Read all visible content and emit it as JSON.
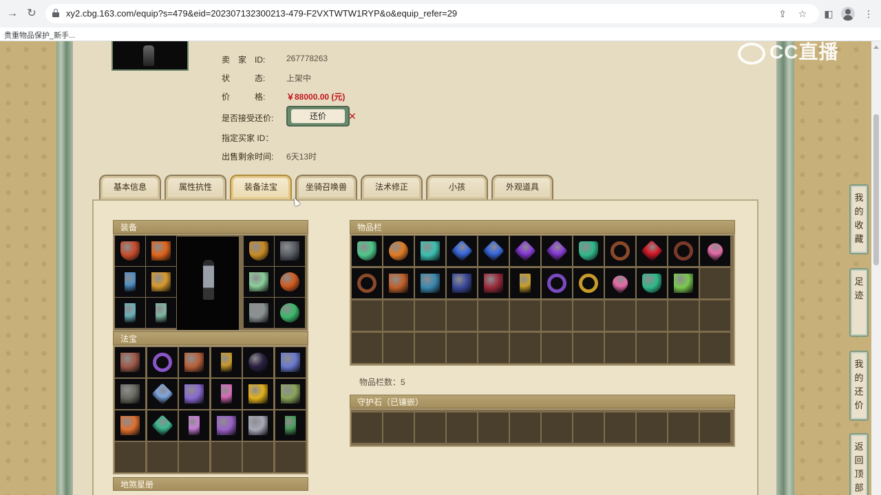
{
  "browser": {
    "url": "xy2.cbg.163.com/equip?s=479&eid=202307132300213-479-F2VXTWTW1RYP&o&equip_refer=29",
    "bookmark": "贵重物品保护_新手..."
  },
  "seller": {
    "seller_label": "卖　家　ID:",
    "seller_id": "267778263",
    "status_label": "状　　　态:",
    "status": "上架中",
    "price_label": "价　　　格:",
    "price": "￥88000.00 (元)",
    "haggle_label": "是否接受还价:",
    "haggle_button": "还价",
    "buyer_label": "指定买家 ID：",
    "remaining_label": "出售剩余时间:",
    "remaining": "6天13时"
  },
  "tabs": [
    {
      "label": "基本信息",
      "active": false
    },
    {
      "label": "属性抗性",
      "active": false
    },
    {
      "label": "装备法宝",
      "active": true
    },
    {
      "label": "坐骑召唤兽",
      "active": false
    },
    {
      "label": "法术修正",
      "active": false
    },
    {
      "label": "小孩",
      "active": false
    },
    {
      "label": "外观道具",
      "active": false
    }
  ],
  "sections": {
    "equipment": "装备",
    "treasure": "法宝",
    "constellation": "地煞星册",
    "inventory": "物品栏",
    "inventory_count": "物品栏数：5",
    "guardstone": "守护石（已镶嵌）"
  },
  "equipment_items": [
    {
      "icon": "hat-icon",
      "color": "#c64b2a"
    },
    {
      "icon": "flame-crown-icon",
      "color": "#e0651c"
    },
    {
      "icon": "mask-icon",
      "color": "#c88a22"
    },
    {
      "icon": "claw-icon",
      "color": "#5a5f66"
    },
    {
      "icon": "sword-icon",
      "color": "#4f8fc4"
    },
    {
      "icon": "robe-icon",
      "color": "#d79a2c"
    },
    {
      "icon": "wing-icon",
      "color": "#8ccf9a"
    },
    {
      "icon": "orb-icon",
      "color": "#d05a1e"
    },
    {
      "icon": "hook-icon",
      "color": "#6ab0b8"
    },
    {
      "icon": "boots-icon",
      "color": "#7fb6a2"
    },
    {
      "icon": "chain-icon",
      "color": "#8a9292"
    },
    {
      "icon": "jade-orb-icon",
      "color": "#3cb86a"
    }
  ],
  "treasure_items": [
    {
      "icon": "tag-icon",
      "color": "#a05a4a"
    },
    {
      "icon": "swirl-icon",
      "color": "#8a55c8"
    },
    {
      "icon": "horn-icon",
      "color": "#b8603a"
    },
    {
      "icon": "pillar-icon",
      "color": "#c89a2a"
    },
    {
      "icon": "dark-orb-icon",
      "color": "#2a2040"
    },
    {
      "icon": "gauntlet-icon",
      "color": "#6a7ad0"
    },
    {
      "icon": "stone-icon",
      "color": "#6a6a62"
    },
    {
      "icon": "crystal-icon",
      "color": "#7ea6e0"
    },
    {
      "icon": "scroll-icon",
      "color": "#8a6ad0"
    },
    {
      "icon": "lantern-icon",
      "color": "#d86ab8"
    },
    {
      "icon": "gold-pile-icon",
      "color": "#e2b21c"
    },
    {
      "icon": "jade-block-icon",
      "color": "#8aa45a"
    },
    {
      "icon": "fire-tablet-icon",
      "color": "#e07030"
    },
    {
      "icon": "emerald-icon",
      "color": "#3cb890"
    },
    {
      "icon": "feather-icon",
      "color": "#c880d8"
    },
    {
      "icon": "gem-basket-icon",
      "color": "#9a62c8"
    },
    {
      "icon": "mirror-icon",
      "color": "#a8a8b8"
    },
    {
      "icon": "chalice-icon",
      "color": "#4a9a5a"
    }
  ],
  "inventory_items": [
    {
      "icon": "leaf-icon",
      "color": "#4fc78a"
    },
    {
      "icon": "fireball-icon",
      "color": "#e07a22"
    },
    {
      "icon": "book-icon",
      "color": "#3cc0b0"
    },
    {
      "icon": "sapphire-icon",
      "color": "#3a6ae0"
    },
    {
      "icon": "sapphire-icon",
      "color": "#3a6ae0"
    },
    {
      "icon": "amethyst-icon",
      "color": "#8a3ad8"
    },
    {
      "icon": "amethyst-icon",
      "color": "#8a3ad8"
    },
    {
      "icon": "jade-drop-icon",
      "color": "#2fb88a"
    },
    {
      "icon": "bracelet-icon",
      "color": "#8a4a2a"
    },
    {
      "icon": "ruby-icon",
      "color": "#d81a2a"
    },
    {
      "icon": "bracelet-icon",
      "color": "#7a3a2a"
    },
    {
      "icon": "heart-gem-icon",
      "color": "#e86aa8"
    },
    {
      "icon": "bracelet-icon",
      "color": "#8a4a2a"
    },
    {
      "icon": "lotus-icon",
      "color": "#c0602a"
    },
    {
      "icon": "robe-icon",
      "color": "#3a88b0"
    },
    {
      "icon": "chest-icon",
      "color": "#3a4a9a"
    },
    {
      "icon": "box-icon",
      "color": "#9a2a3a"
    },
    {
      "icon": "golden-boots-icon",
      "color": "#c8a02a"
    },
    {
      "icon": "necklace-icon",
      "color": "#7a4ac0"
    },
    {
      "icon": "gold-ring-icon",
      "color": "#c89a2a"
    },
    {
      "icon": "heart-gem-icon",
      "color": "#e86aa8"
    },
    {
      "icon": "jade-drop-icon",
      "color": "#2fb88a"
    },
    {
      "icon": "green-scroll-icon",
      "color": "#7ac850"
    }
  ],
  "sidebar": [
    {
      "label": "我的收藏"
    },
    {
      "label": "足迹"
    },
    {
      "label": "我的还价"
    },
    {
      "label": "返回顶部"
    }
  ],
  "watermark": "CC直播",
  "colors": {
    "price": "#c0161d",
    "section_header": "#a48e5d",
    "empty_slot": "#4a3f2d"
  }
}
